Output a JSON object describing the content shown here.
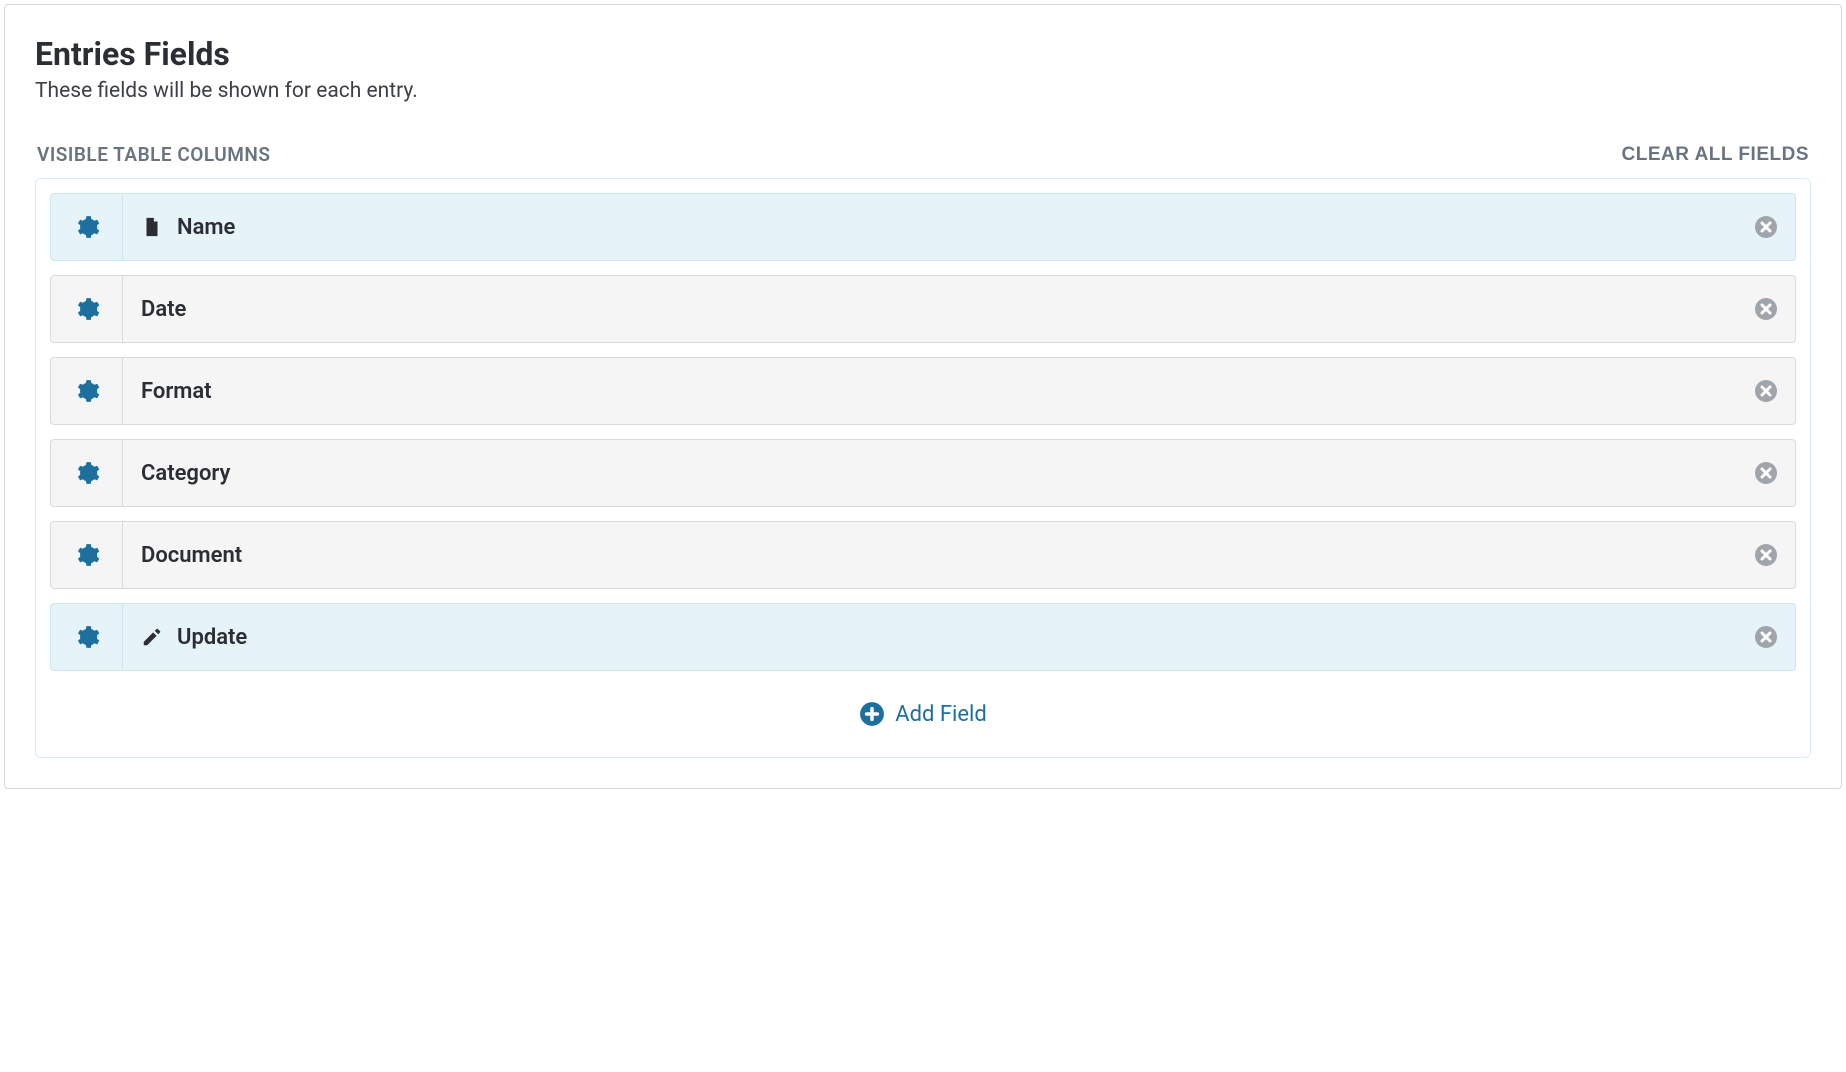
{
  "header": {
    "title": "Entries Fields",
    "subtitle": "These fields will be shown for each entry."
  },
  "columns": {
    "label": "Visible Table Columns",
    "clear_all": "Clear all fields"
  },
  "fields": [
    {
      "label": "Name",
      "icon": "file",
      "highlighted": true
    },
    {
      "label": "Date",
      "icon": null,
      "highlighted": false
    },
    {
      "label": "Format",
      "icon": null,
      "highlighted": false
    },
    {
      "label": "Category",
      "icon": null,
      "highlighted": false
    },
    {
      "label": "Document",
      "icon": null,
      "highlighted": false
    },
    {
      "label": "Update",
      "icon": "edit",
      "highlighted": true
    }
  ],
  "add_field": {
    "label": "Add Field"
  }
}
